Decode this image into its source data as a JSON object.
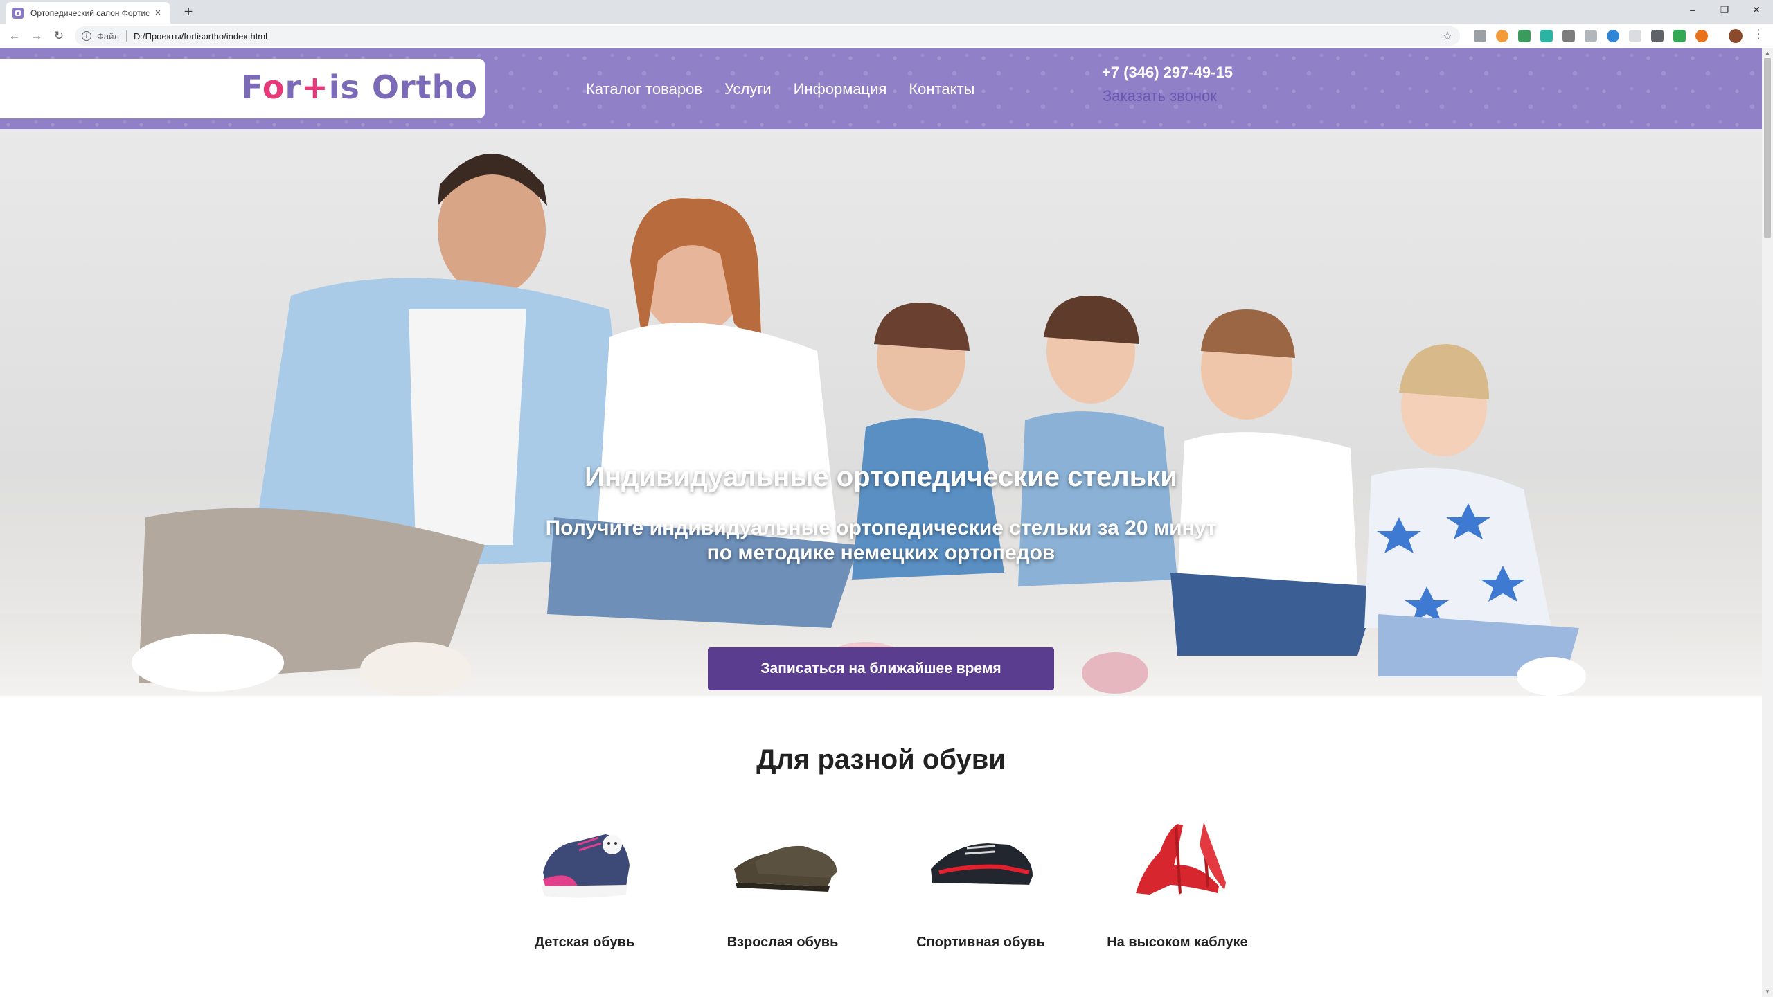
{
  "browser": {
    "tab_title": "Ортопедический салон Фортис",
    "tab_close": "×",
    "new_tab": "+",
    "window_controls": [
      "–",
      "❐",
      "✕"
    ],
    "omnibox_label": "Файл",
    "url": "D:/Проекты/fortisortho/index.html"
  },
  "header": {
    "logo": {
      "part1": "F",
      "o_mark": "o",
      "part2": "r",
      "plus": "+",
      "part3": "is Ortho"
    },
    "nav": [
      "Каталог товаров",
      "Услуги",
      "Информация",
      "Контакты"
    ],
    "phone": "+7 (346) 297-49-15",
    "callback": "Заказать звонок"
  },
  "hero": {
    "title": "Индивидуальные ортопедические стельки",
    "subtitle_line1": "Получите индивидуальные ортопедические стельки за 20 минут",
    "subtitle_line2": "по методике немецких ортопедов",
    "cta": "Записаться на ближайшее время"
  },
  "section": {
    "title": "Для разной обуви",
    "items": [
      {
        "label": "Детская обувь",
        "icon": "kids-shoe-icon"
      },
      {
        "label": "Взрослая обувь",
        "icon": "adult-shoe-icon"
      },
      {
        "label": "Спортивная обувь",
        "icon": "sneaker-icon"
      },
      {
        "label": "На высоком каблуке",
        "icon": "high-heel-icon"
      }
    ]
  },
  "colors": {
    "header_bg": "#8f80c8",
    "accent": "#5a3d8f",
    "logo_purple": "#7b6ab8",
    "logo_pink": "#e63a7a"
  }
}
